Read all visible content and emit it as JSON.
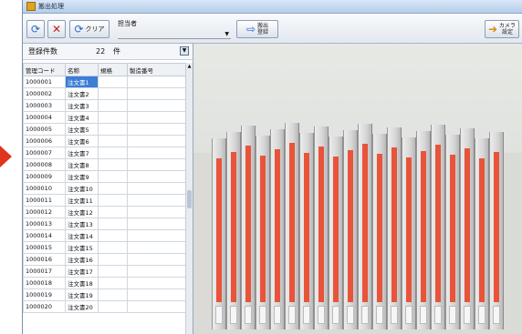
{
  "window": {
    "title": "搬出処理"
  },
  "toolbar": {
    "refresh_icon": "refresh-icon",
    "delete_icon": "delete-x-icon",
    "clear_label": "クリア",
    "assignee_label": "担当者",
    "assignee_value": "",
    "export_line1": "搬出",
    "export_line2": "登録",
    "camera_line1": "カメラ",
    "camera_line2": "設定"
  },
  "summary": {
    "label": "登録件数",
    "count": "22",
    "unit": "件"
  },
  "table": {
    "columns": [
      "管理コード",
      "名称",
      "規格",
      "製造番号"
    ],
    "rows": [
      [
        "1000001",
        "注文書1",
        "",
        ""
      ],
      [
        "1000002",
        "注文書2",
        "",
        ""
      ],
      [
        "1000003",
        "注文書3",
        "",
        ""
      ],
      [
        "1000004",
        "注文書4",
        "",
        ""
      ],
      [
        "1000005",
        "注文書5",
        "",
        ""
      ],
      [
        "1000006",
        "注文書6",
        "",
        ""
      ],
      [
        "1000007",
        "注文書7",
        "",
        ""
      ],
      [
        "1000008",
        "注文書8",
        "",
        ""
      ],
      [
        "1000009",
        "注文書9",
        "",
        ""
      ],
      [
        "1000010",
        "注文書10",
        "",
        ""
      ],
      [
        "1000011",
        "注文書11",
        "",
        ""
      ],
      [
        "1000012",
        "注文書12",
        "",
        ""
      ],
      [
        "1000013",
        "注文書13",
        "",
        ""
      ],
      [
        "1000014",
        "注文書14",
        "",
        ""
      ],
      [
        "1000015",
        "注文書15",
        "",
        ""
      ],
      [
        "1000016",
        "注文書16",
        "",
        ""
      ],
      [
        "1000017",
        "注文書17",
        "",
        ""
      ],
      [
        "1000018",
        "注文書18",
        "",
        ""
      ],
      [
        "1000019",
        "注文書19",
        "",
        ""
      ],
      [
        "1000020",
        "注文書20",
        "",
        ""
      ]
    ],
    "selected_row": 0
  },
  "colors": {
    "accent_arrow": "#e0351d",
    "selection": "#3c7ed6",
    "binder_label": "#e8543a"
  }
}
